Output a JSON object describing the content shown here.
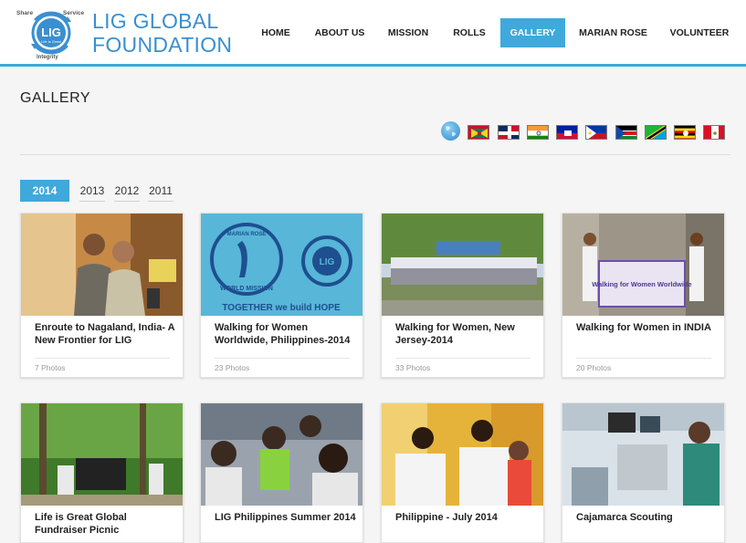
{
  "brand": {
    "name_line1": "LIG GLOBAL",
    "name_line2": "FOUNDATION",
    "emblem_center": "LIG",
    "emblem_sub": "Life is Great",
    "emblem_word_share": "Share",
    "emblem_word_service": "Service",
    "emblem_word_integrity": "Integrity",
    "color": "#3a8fd0"
  },
  "nav": {
    "items": [
      {
        "label": "HOME",
        "active": false
      },
      {
        "label": "ABOUT US",
        "active": false
      },
      {
        "label": "MISSION",
        "active": false
      },
      {
        "label": "ROLLS",
        "active": false
      },
      {
        "label": "GALLERY",
        "active": true
      },
      {
        "label": "MARIAN ROSE",
        "active": false
      },
      {
        "label": "VOLUNTEER",
        "active": false
      }
    ],
    "accent": "#3fa9dc"
  },
  "page": {
    "title": "GALLERY"
  },
  "languages": {
    "globe_icon": "globe-icon",
    "flags": [
      "grenada-flag",
      "dominican-republic-flag",
      "india-flag",
      "haiti-flag",
      "philippines-flag",
      "south-sudan-flag",
      "tanzania-flag",
      "uganda-flag",
      "peru-flag"
    ]
  },
  "years": {
    "tabs": [
      {
        "label": "2014",
        "active": true
      },
      {
        "label": "2013",
        "active": false
      },
      {
        "label": "2012",
        "active": false
      },
      {
        "label": "2011",
        "active": false
      }
    ]
  },
  "albums": [
    {
      "title": "Enroute to Nagaland, India- A New Frontier for LIG",
      "count": "7 Photos"
    },
    {
      "title": "Walking for Women Worldwide, Philippines-2014",
      "count": "23 Photos",
      "shirt_line1": "MARIAN ROSE",
      "shirt_line2": "WORLD MISSION",
      "shirt_line3": "TOGETHER we build HOPE"
    },
    {
      "title": "Walking for Women, New Jersey-2014",
      "count": "33 Photos"
    },
    {
      "title": "Walking for Women in INDIA",
      "count": "20 Photos",
      "banner_text": "Walking for Women Worldwide"
    },
    {
      "title": "Life is Great Global Fundraiser Picnic",
      "count": ""
    },
    {
      "title": "LIG Philippines Summer 2014",
      "count": ""
    },
    {
      "title": "Philippine - July 2014",
      "count": ""
    },
    {
      "title": "Cajamarca Scouting",
      "count": ""
    }
  ]
}
